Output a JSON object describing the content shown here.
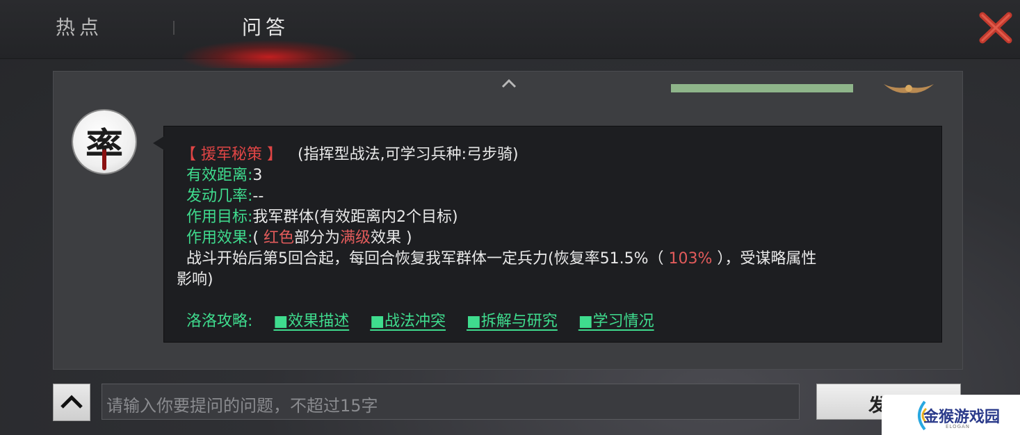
{
  "tabs": {
    "hot": "热点",
    "qa": "问答",
    "active": "问答"
  },
  "skill": {
    "name": "【 援军秘策 】",
    "type": "(指挥型战法,可学习兵种:弓步骑)",
    "range_label": "有效距离:",
    "range_value": "3",
    "chance_label": "发动几率:",
    "chance_value": "--",
    "target_label": "作用目标:",
    "target_value": "我军群体(有效距离内2个目标)",
    "effect_label": "作用效果:",
    "effect_note_open": "( ",
    "effect_note_red": "红色",
    "effect_note_mid": "部分为",
    "effect_note_max": "满级",
    "effect_note_close": "效果 )",
    "desc_part1": "战斗开始后第5回合起，每回合恢复我军群体一定兵力(恢复率51.5%（ ",
    "desc_red": "103%",
    "desc_part2": " ），受谋略属性",
    "desc_line2": "影响)"
  },
  "guide": {
    "label": "洛洛攻略:",
    "links": [
      "■效果描述",
      "■战法冲突",
      "■拆解与研究",
      "■学习情况"
    ]
  },
  "avatar_char": "率",
  "input": {
    "placeholder": "请输入你要提问的问题，不超过15字"
  },
  "send_label": "发送",
  "watermark": {
    "text": "金猴游戏园",
    "sub": "ELOGAN"
  },
  "progress": {
    "fraction": 1.0,
    "color": "#8fb58a"
  },
  "colors": {
    "accent_green": "#3fdc8e",
    "accent_red": "#e04545"
  }
}
